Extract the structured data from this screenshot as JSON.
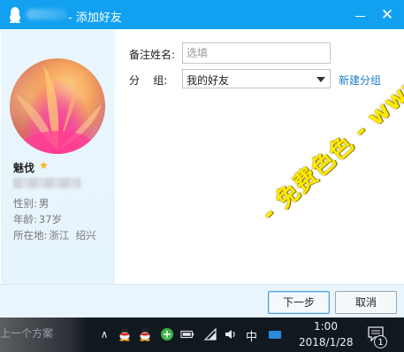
{
  "window": {
    "title": "- 添加好友",
    "minimize_label": "–",
    "close_label": "✕"
  },
  "profile": {
    "nickname": "魅伐",
    "gender_label": "性别:",
    "gender_value": "男",
    "age_label": "年龄:",
    "age_value": "37岁",
    "location_label": "所在地:",
    "location_value": "浙江  绍兴"
  },
  "form": {
    "remark_label": "备注姓名:",
    "remark_placeholder": "选填",
    "group_label": "分    组:",
    "group_value": "我的好友",
    "new_group_link": "新建分组"
  },
  "buttons": {
    "next": "下一步",
    "cancel": "取消"
  },
  "taskbar": {
    "behind_text": "上一个方案",
    "ime": "中",
    "time": "1:00",
    "date": "2018/1/28",
    "notification_count": "1",
    "chevron": "∧"
  },
  "watermark": {
    "text": "- 免费色色 - www.MFsese.com"
  },
  "colors": {
    "titlebar": "#12a1f0",
    "link": "#1e7ec8",
    "star": "#f2b21b",
    "watermark": "#ffea00"
  }
}
